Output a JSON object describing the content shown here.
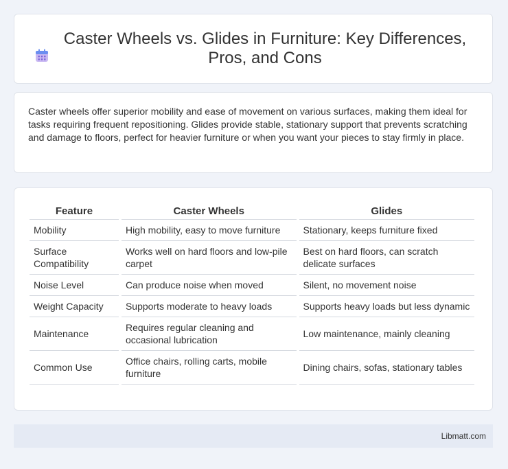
{
  "header": {
    "title": "Caster Wheels vs. Glides in Furniture: Key Differences, Pros, and Cons",
    "icon": "calendar-icon"
  },
  "summary": {
    "text": "Caster wheels offer superior mobility and ease of movement on various surfaces, making them ideal for tasks requiring frequent repositioning. Glides provide stable, stationary support that prevents scratching and damage to floors, perfect for heavier furniture or when you want your pieces to stay firmly in place."
  },
  "table": {
    "headers": [
      "Feature",
      "Caster Wheels",
      "Glides"
    ],
    "rows": [
      [
        "Mobility",
        "High mobility, easy to move furniture",
        "Stationary, keeps furniture fixed"
      ],
      [
        "Surface Compatibility",
        "Works well on hard floors and low-pile carpet",
        "Best on hard floors, can scratch delicate surfaces"
      ],
      [
        "Noise Level",
        "Can produce noise when moved",
        "Silent, no movement noise"
      ],
      [
        "Weight Capacity",
        "Supports moderate to heavy loads",
        "Supports heavy loads but less dynamic"
      ],
      [
        "Maintenance",
        "Requires regular cleaning and occasional lubrication",
        "Low maintenance, mainly cleaning"
      ],
      [
        "Common Use",
        "Office chairs, rolling carts, mobile furniture",
        "Dining chairs, sofas, stationary tables"
      ]
    ]
  },
  "footer": {
    "brand": "Libmatt.com"
  }
}
